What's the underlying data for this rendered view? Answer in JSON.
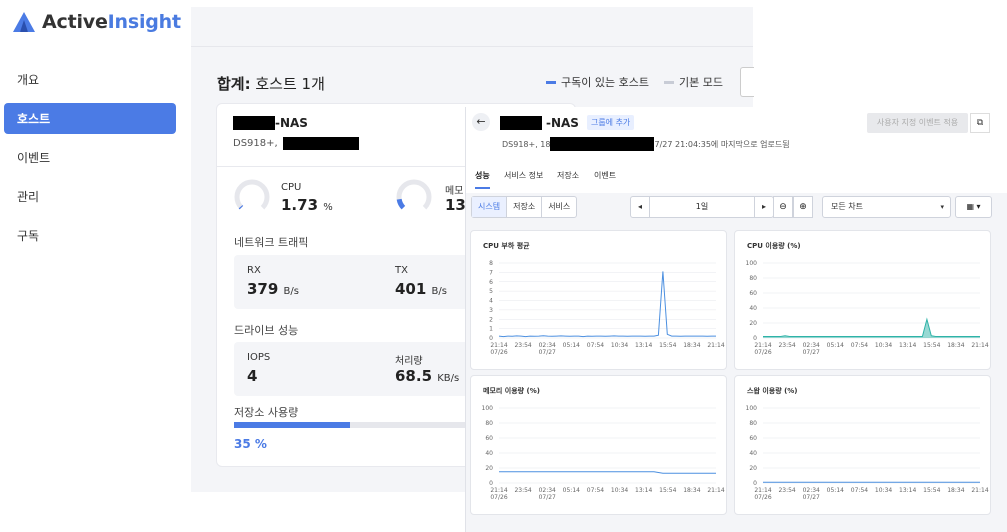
{
  "app": {
    "logo_part1": "Active",
    "logo_part2": "Insight",
    "accent": "#4b7be5"
  },
  "sidebar": {
    "items": [
      {
        "label": "개요"
      },
      {
        "label": "호스트",
        "active": true
      },
      {
        "label": "이벤트"
      },
      {
        "label": "관리"
      },
      {
        "label": "구독"
      }
    ]
  },
  "summary": {
    "title_prefix": "합계:",
    "title_rest": " 호스트 1개",
    "legend": [
      {
        "label": "구독이 있는 호스트",
        "color": "#4b7be5"
      },
      {
        "label": "기본 모드",
        "color": "#c8ccd6"
      }
    ]
  },
  "host": {
    "name_suffix": "-NAS",
    "model_prefix": "DS918+,",
    "cpu_label": "CPU",
    "cpu_value": "1.73",
    "cpu_unit": "%",
    "cpu_fraction": 0.0173,
    "mem_label": "메모",
    "mem_value": "13.",
    "mem_fraction": 0.135,
    "net_label": "네트워크 트래픽",
    "rx_label": "RX",
    "rx_value": "379",
    "rx_unit": "B/s",
    "tx_label": "TX",
    "tx_value": "401",
    "tx_unit": "B/s",
    "drive_label": "드라이브 성능",
    "iops_label": "IOPS",
    "iops_value": "4",
    "thru_label": "처리량",
    "thru_value": "68.5",
    "thru_unit": "KB/s",
    "storage_label": "저장소 사용량",
    "storage_value": "35 %",
    "storage_fraction": 0.35
  },
  "detail": {
    "name_suffix": "-NAS",
    "group_badge": "그룹에 추가",
    "sub_prefix": "DS918+, 18",
    "sub_suffix": "7/27 21:04:35에 마지막으로 업로드됨",
    "apply_button": "사용자 지정 이벤트 적용",
    "tabs": [
      {
        "label": "성능",
        "active": true
      },
      {
        "label": "서비스 정보"
      },
      {
        "label": "저장소"
      },
      {
        "label": "이벤트"
      }
    ],
    "segments": [
      {
        "label": "시스템",
        "active": true
      },
      {
        "label": "저장소"
      },
      {
        "label": "서비스"
      }
    ],
    "period_label": "1일",
    "chart_select": "모든 차트",
    "back_icon": "arrow-left-icon",
    "ext_icon": "external-link-icon",
    "zoom_out_icon": "zoom-out-icon",
    "zoom_in_icon": "zoom-in-icon",
    "calendar_icon": "calendar-icon"
  },
  "chart_data": [
    {
      "type": "line",
      "title": "CPU 부하 평균",
      "ylim": [
        0,
        8
      ],
      "yticks": [
        "8",
        "7",
        "6",
        "5",
        "4",
        "3",
        "2",
        "1",
        "0"
      ],
      "xticks": [
        "21:14\n07/26",
        "23:54",
        "02:34\n07/27",
        "05:14",
        "07:54",
        "10:34",
        "13:14",
        "15:54",
        "18:34",
        "21:14"
      ],
      "color": "#4b8fe0",
      "values": [
        0.2,
        0.15,
        0.2,
        0.18,
        0.22,
        0.2,
        0.15,
        0.2,
        0.18,
        0.2,
        0.25,
        0.2,
        0.18,
        0.2,
        0.22,
        0.2,
        0.18,
        0.2,
        0.2,
        0.15,
        0.2,
        0.18,
        0.2,
        0.2,
        0.18,
        0.2,
        0.22,
        0.2,
        0.2,
        0.18,
        0.2,
        0.2,
        0.2,
        0.18,
        0.2,
        0.2,
        0.3,
        7.1,
        0.4,
        0.2,
        0.2,
        0.18,
        0.2,
        0.2,
        0.2,
        0.2,
        0.2,
        0.18,
        0.2,
        0.2
      ]
    },
    {
      "type": "area",
      "title": "CPU 이용량 (%)",
      "ylim": [
        0,
        100
      ],
      "yticks": [
        "100",
        "80",
        "60",
        "40",
        "20",
        "0"
      ],
      "xticks": [
        "21:14\n07/26",
        "23:54",
        "02:34\n07/27",
        "05:14",
        "07:54",
        "10:34",
        "13:14",
        "15:54",
        "18:34",
        "21:14"
      ],
      "color": "#2fb3a8",
      "values": [
        2,
        2,
        2,
        2,
        2,
        3,
        2,
        2,
        2,
        2,
        2,
        2,
        2,
        2,
        2,
        2,
        2,
        2,
        2,
        2,
        2,
        2,
        2,
        2,
        2,
        2,
        2,
        2,
        2,
        2,
        2,
        2,
        2,
        2,
        2,
        2,
        2,
        25,
        3,
        2,
        2,
        2,
        2,
        2,
        2,
        2,
        2,
        2,
        2,
        2
      ]
    },
    {
      "type": "line",
      "title": "메모리 이용량 (%)",
      "ylim": [
        0,
        100
      ],
      "yticks": [
        "100",
        "80",
        "60",
        "40",
        "20",
        "0"
      ],
      "xticks": [
        "21:14\n07/26",
        "23:54",
        "02:34\n07/27",
        "05:14",
        "07:54",
        "10:34",
        "13:14",
        "15:54",
        "18:34",
        "21:14"
      ],
      "color": "#4b8fe0",
      "values": [
        15,
        15,
        15,
        15,
        15,
        15,
        15,
        15,
        15,
        15,
        15,
        15,
        15,
        15,
        15,
        15,
        15,
        15,
        15,
        15,
        15,
        15,
        15,
        15,
        15,
        15,
        15,
        15,
        15,
        15,
        15,
        15,
        15,
        15,
        15,
        15,
        14,
        13,
        13,
        13,
        13,
        13,
        13,
        13,
        13,
        13,
        13,
        13,
        13,
        13
      ]
    },
    {
      "type": "line",
      "title": "스왑 이용량 (%)",
      "ylim": [
        0,
        100
      ],
      "yticks": [
        "100",
        "80",
        "60",
        "40",
        "20",
        "0"
      ],
      "xticks": [
        "21:14\n07/26",
        "23:54",
        "02:34\n07/27",
        "05:14",
        "07:54",
        "10:34",
        "13:14",
        "15:54",
        "18:34",
        "21:14"
      ],
      "color": "#4b8fe0",
      "values": [
        1,
        1,
        1,
        1,
        1,
        1,
        1,
        1,
        1,
        1,
        1,
        1,
        1,
        1,
        1,
        1,
        1,
        1,
        1,
        1,
        1,
        1,
        1,
        1,
        1,
        1,
        1,
        1,
        1,
        1,
        1,
        1,
        1,
        1,
        1,
        1,
        1,
        1,
        1,
        1,
        1,
        1,
        1,
        1,
        1,
        1,
        1,
        1,
        1,
        1
      ]
    }
  ]
}
